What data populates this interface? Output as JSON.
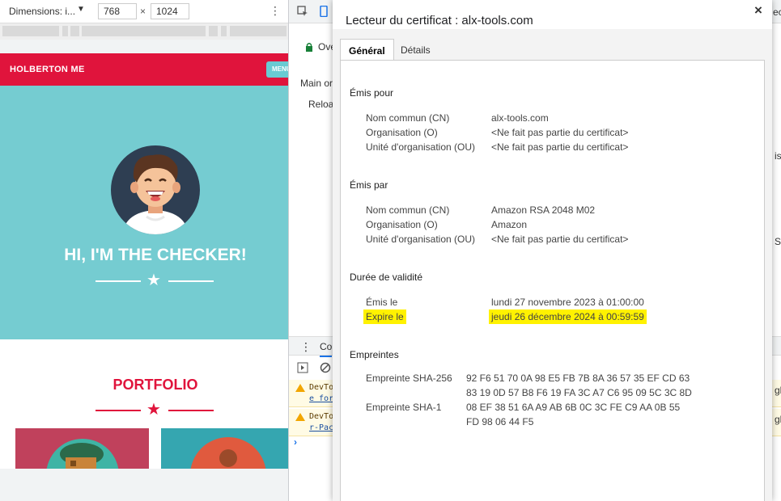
{
  "device_toolbar": {
    "dimensions_label": "Dimensions: i...",
    "width": "768",
    "height": "1024",
    "x_sep": "×",
    "more_icon": "kebab-menu-icon"
  },
  "site": {
    "brand": "HOLBERTON ME",
    "menu_label": "MENU",
    "hero_title": "HI, I'M THE CHECKER!",
    "portfolio_title": "PORTFOLIO",
    "colors": {
      "nav": "#e0143c",
      "hero": "#75ccd1",
      "accent": "#e0143c"
    }
  },
  "devtools": {
    "tab_overview": "Ove",
    "main_origin": "Main or",
    "reload": "Reloa",
    "console_tab": "Co",
    "warnings": [
      {
        "line1": "DevTo",
        "line2": "e for"
      },
      {
        "line1": "DevTo",
        "line2": "r-Pac"
      }
    ],
    "right_edge_texts": [
      "ec",
      "is",
      "S",
      "gh",
      "gh"
    ]
  },
  "dialog": {
    "title": "Lecteur du certificat : alx-tools.com",
    "close": "×",
    "tabs": [
      {
        "label": "Général",
        "active": true
      },
      {
        "label": "Détails",
        "active": false
      }
    ],
    "issued_to": {
      "heading": "Émis pour",
      "rows": [
        {
          "label": "Nom commun (CN)",
          "value": "alx-tools.com"
        },
        {
          "label": "Organisation (O)",
          "value": "<Ne fait pas partie du certificat>"
        },
        {
          "label": "Unité d'organisation (OU)",
          "value": "<Ne fait pas partie du certificat>"
        }
      ]
    },
    "issued_by": {
      "heading": "Émis par",
      "rows": [
        {
          "label": "Nom commun (CN)",
          "value": "Amazon RSA 2048 M02"
        },
        {
          "label": "Organisation (O)",
          "value": "Amazon"
        },
        {
          "label": "Unité d'organisation (OU)",
          "value": "<Ne fait pas partie du certificat>"
        }
      ]
    },
    "validity": {
      "heading": "Durée de validité",
      "issued_label": "Émis le",
      "issued_value": "lundi 27 novembre 2023 à 01:00:00",
      "expires_label": "Expire le",
      "expires_value": "jeudi 26 décembre 2024 à 00:59:59",
      "highlight_color": "#fff200"
    },
    "fingerprints": {
      "heading": "Empreintes",
      "sha256_label": "Empreinte SHA-256",
      "sha256_value": "92 F6 51 70 0A 98 E5 FB 7B 8A 36 57 35 EF CD 63 83 19 0D 57 B8 F6 19 FA 3C A7 C6 95 09 5C 3C 8D",
      "sha1_label": "Empreinte SHA-1",
      "sha1_value": "08 EF 38 51 6A A9 AB 6B 0C 3C FE C9 AA 0B 55 FD 98 06 44 F5"
    }
  }
}
